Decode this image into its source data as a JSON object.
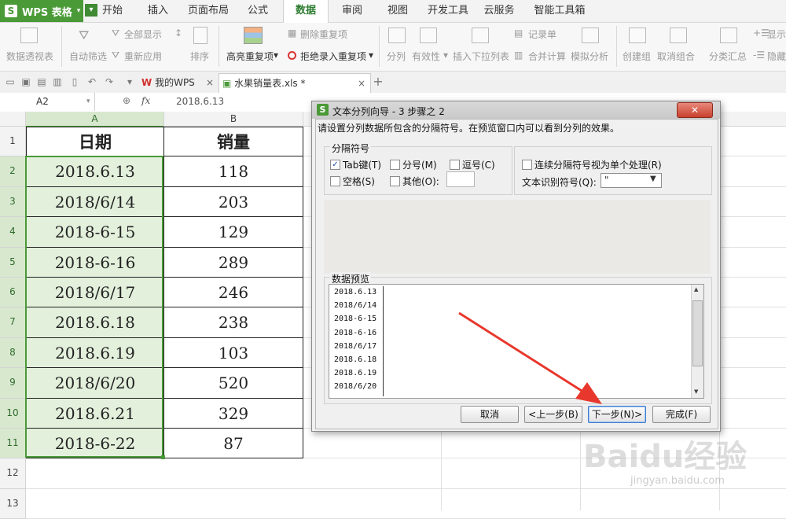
{
  "app": {
    "logo_text": "WPS 表格"
  },
  "menu": {
    "tabs": [
      "开始",
      "插入",
      "页面布局",
      "公式",
      "数据",
      "审阅",
      "视图",
      "开发工具",
      "云服务",
      "智能工具箱"
    ],
    "active": "数据"
  },
  "ribbon": {
    "pivot": "数据透视表",
    "autofilter": "自动筛选",
    "show_all": "全部显示",
    "reapply": "重新应用",
    "sort": "排序",
    "highlight_dup": "高亮重复项",
    "delete_dup": "删除重复项",
    "reject_dup": "拒绝录入重复项",
    "split": "分列",
    "validity": "有效性",
    "insert_dropdown": "插入下拉列表",
    "record_form": "记录单",
    "merge_calc": "合并计算",
    "sim_analysis": "模拟分析",
    "create_group": "创建组",
    "ungroup": "取消组合",
    "subtotal": "分类汇总",
    "show_detail": "显示",
    "hide_detail": "隐藏"
  },
  "doc_tabs": [
    {
      "label": "我的WPS"
    },
    {
      "label": "水果销量表.xls *"
    }
  ],
  "name_box": "A2",
  "formula_icon": "fx",
  "formula_value": "2018.6.13",
  "columns": [
    "A",
    "B"
  ],
  "rows": [
    "1",
    "2",
    "3",
    "4",
    "5",
    "6",
    "7",
    "8",
    "9",
    "10",
    "11",
    "12",
    "13"
  ],
  "table": {
    "headers": [
      "日期",
      "销量"
    ],
    "dates": [
      "2018.6.13",
      "2018/6/14",
      "2018-6-15",
      "2018-6-16",
      "2018/6/17",
      "2018.6.18",
      "2018.6.19",
      "2018/6/20",
      "2018.6.21",
      "2018-6-22"
    ],
    "sales": [
      "118",
      "203",
      "129",
      "289",
      "246",
      "238",
      "103",
      "520",
      "329",
      "87"
    ]
  },
  "dialog": {
    "title": "文本分列向导 - 3 步骤之 2",
    "instruction": "请设置分列数据所包含的分隔符号。在预览窗口内可以看到分列的效果。",
    "delimiters_group": "分隔符号",
    "tab": "Tab键(T)",
    "semicolon": "分号(M)",
    "comma": "逗号(C)",
    "space": "空格(S)",
    "other": "其他(O):",
    "consecutive": "连续分隔符号视为单个处理(R)",
    "qualifier_label": "文本识别符号(Q):",
    "qualifier_value": "\"",
    "preview_label": "数据预览",
    "preview_lines": [
      "2018.6.13",
      "2018/6/14",
      "2018-6-15",
      "2018-6-16",
      "2018/6/17",
      "2018.6.18",
      "2018.6.19",
      "2018/6/20"
    ],
    "buttons": {
      "cancel": "取消",
      "back": "<上一步(B)",
      "next": "下一步(N)>",
      "finish": "完成(F)"
    }
  },
  "watermark": {
    "brand": "Baidu经验",
    "url": "jingyan.baidu.com"
  },
  "colors": {
    "accent": "#4a9a38",
    "arrow": "#e8382d"
  }
}
